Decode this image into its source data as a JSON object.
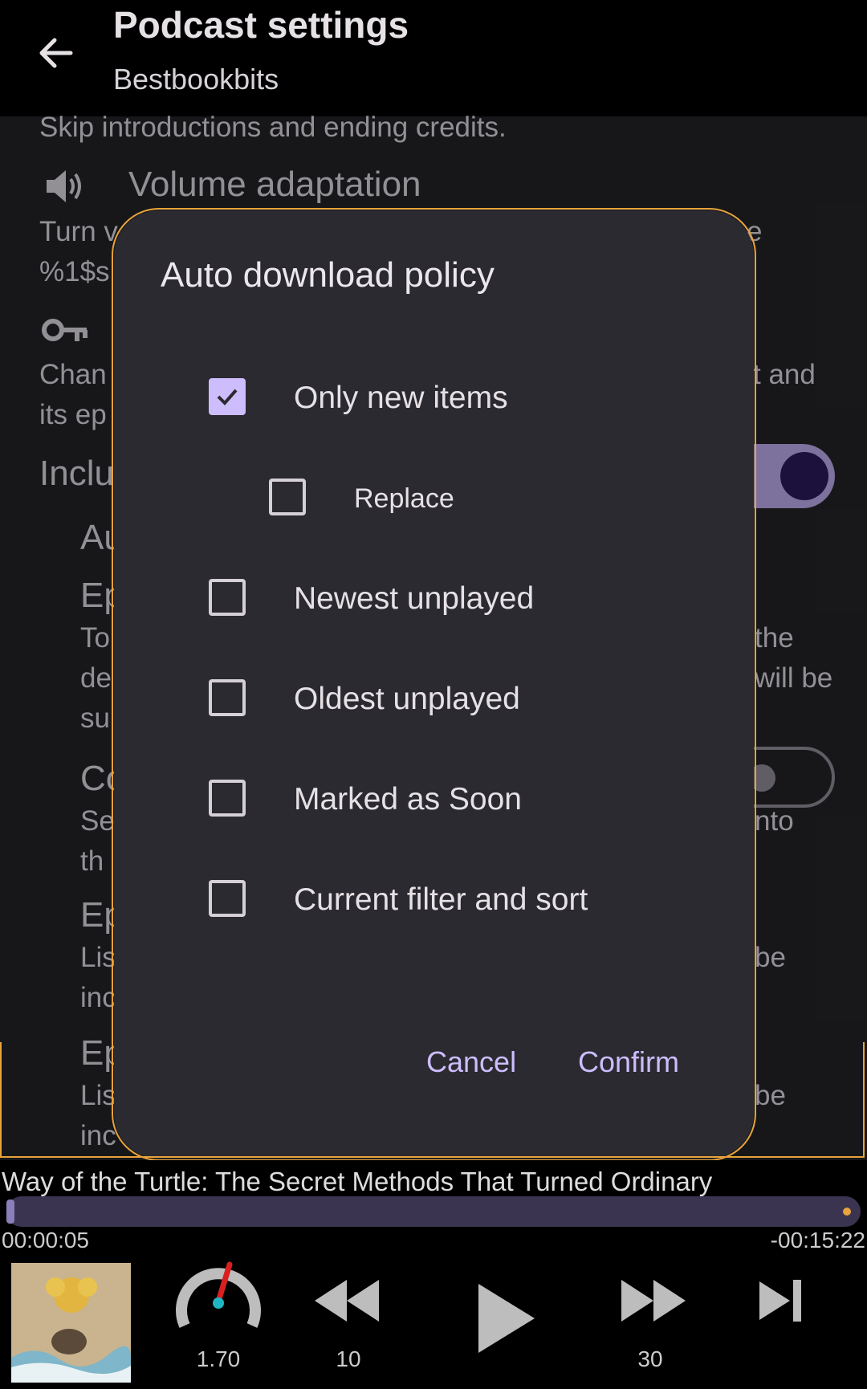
{
  "appbar": {
    "title": "Podcast settings",
    "subtitle": "Bestbookbits",
    "back_icon": "arrow-left-icon"
  },
  "background": {
    "skip_desc": "Skip introductions and ending credits.",
    "volume_title": "Volume adaptation",
    "volume_icon": "speaker-icon",
    "volume_desc_left": "Turn v",
    "volume_desc_right": "e",
    "volume_desc_line2": "%1$s",
    "auth_icon": "key-icon",
    "auth_desc_left": "Chan",
    "auth_desc_right": "t and",
    "auth_desc_line2": "its ep",
    "include_title": "Inclu",
    "auto_title": "Au",
    "ep1_title": "Ep",
    "ep1_l1_left": "To",
    "ep1_l1_right": "the",
    "ep1_l2_left": "de",
    "ep1_l2_right": "will be",
    "ep1_l3_left": "su",
    "co_title": "Co",
    "co_l1_left": "Se",
    "co_l1_right": "nto",
    "co_l2_left": "th",
    "ep2_title": "Ep",
    "ep2_l1_left": "Lis",
    "ep2_l1_right": "be",
    "ep2_l2_left": "inc",
    "ep3_title": "Ep",
    "ep3_l1_left": "Lis",
    "ep3_l1_right": "be",
    "ep3_l2_left": "inc",
    "toggle_on_color": "#b9a7e8",
    "toggle_thumb_color": "#2a1a5a"
  },
  "dialog": {
    "title": "Auto download policy",
    "options": [
      {
        "label": "Only new items",
        "checked": true
      },
      {
        "label": "Replace",
        "checked": false
      },
      {
        "label": "Newest unplayed",
        "checked": false
      },
      {
        "label": "Oldest unplayed",
        "checked": false
      },
      {
        "label": "Marked as Soon",
        "checked": false
      },
      {
        "label": "Current filter and sort",
        "checked": false
      }
    ],
    "cancel": "Cancel",
    "confirm": "Confirm",
    "accent": "#cdbdfd"
  },
  "player": {
    "track_title": "Way of the Turtle: The Secret Methods That Turned Ordinary",
    "elapsed": "00:00:05",
    "remaining": "-00:15:22",
    "progress_fraction": 0.006,
    "speed": "1.70",
    "rewind": "10",
    "forward": "30",
    "icons": [
      "speed-gauge-icon",
      "rewind-icon",
      "play-icon",
      "fast-forward-icon",
      "skip-next-icon"
    ]
  }
}
